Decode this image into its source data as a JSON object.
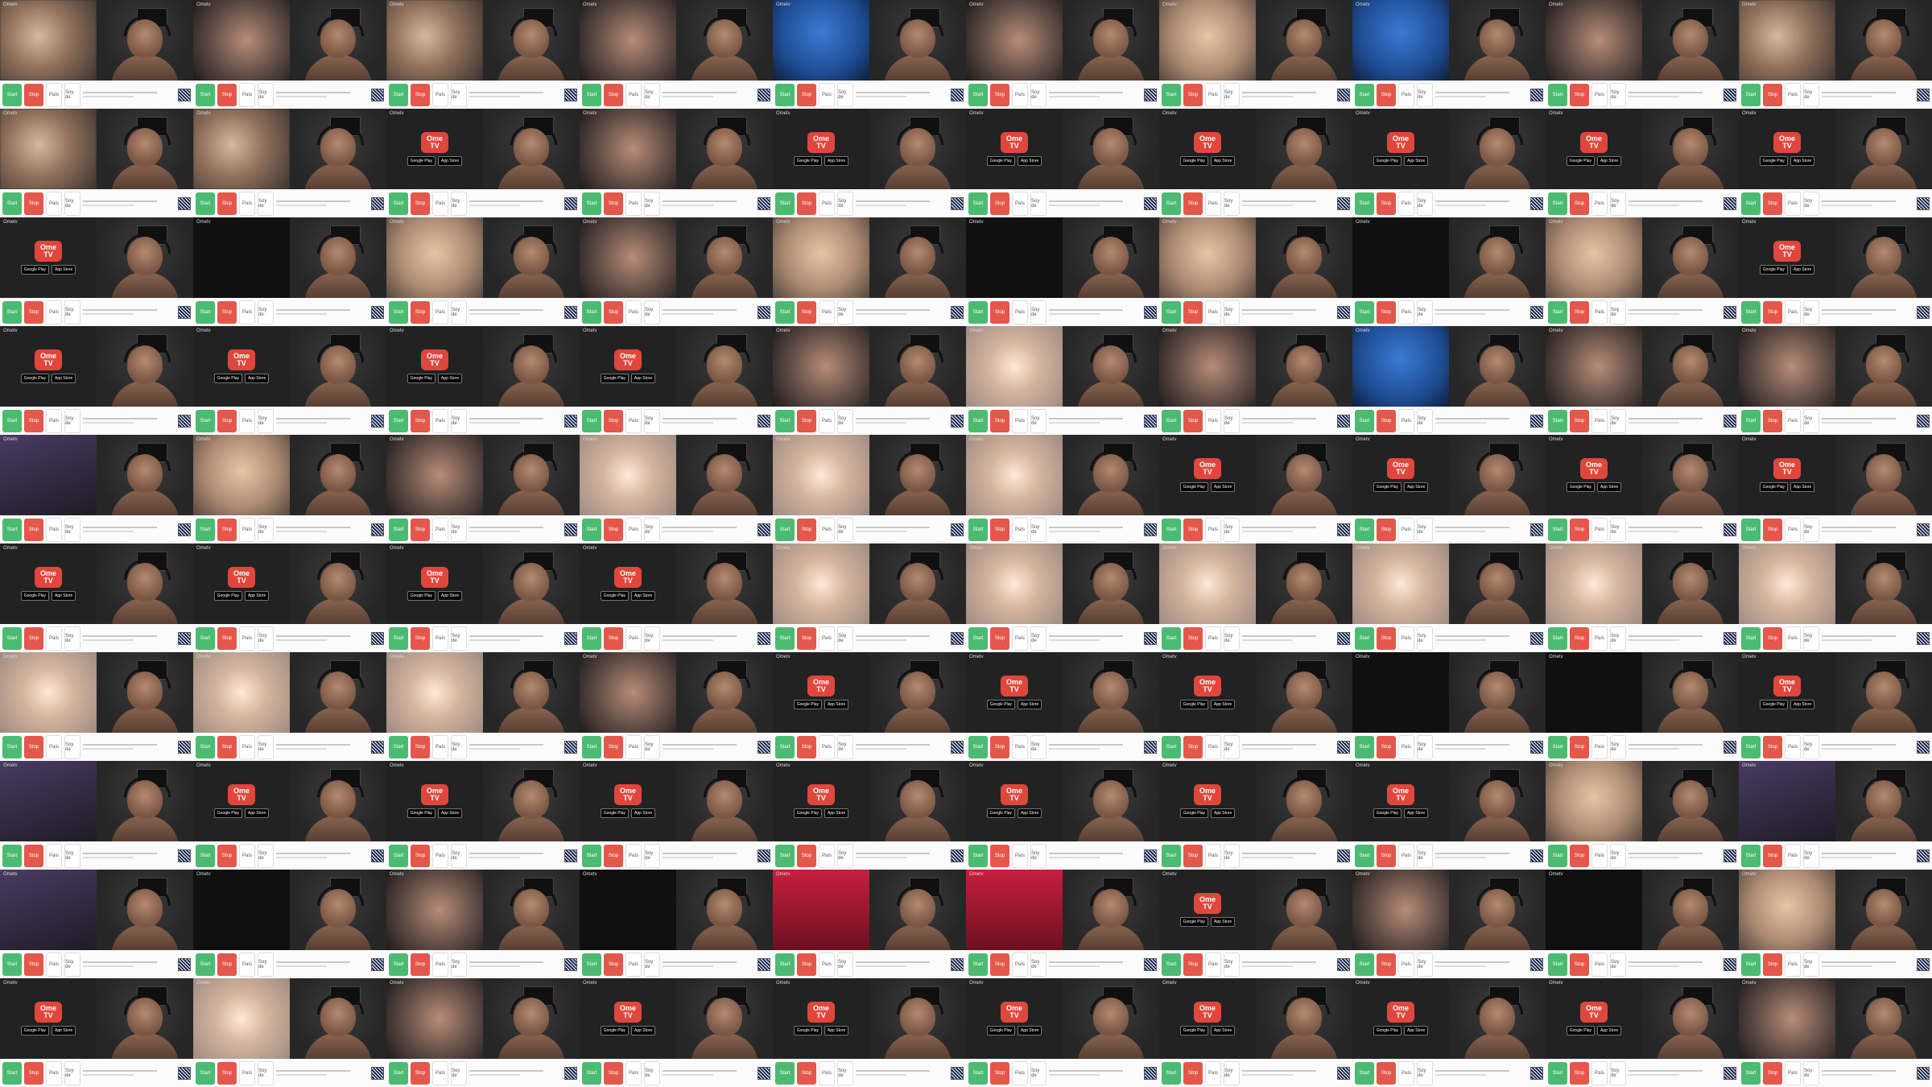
{
  "app": {
    "logo_text": "Ometv"
  },
  "promo": {
    "logo_line1": "Ome",
    "logo_line2": "TV",
    "store1": "Google Play",
    "store2": "App Store"
  },
  "controls": {
    "start_label": "Start",
    "stop_label": "Stop",
    "country_label": "País",
    "gender_label": "Soy de"
  },
  "frames": [
    {
      "remote": "blur-a"
    },
    {
      "remote": "blur-b"
    },
    {
      "remote": "blur-a"
    },
    {
      "remote": "blur-b"
    },
    {
      "remote": "blur-f"
    },
    {
      "remote": "blur-b"
    },
    {
      "remote": "blur-h"
    },
    {
      "remote": "blur-f"
    },
    {
      "remote": "blur-b"
    },
    {
      "remote": "blur-a"
    },
    {
      "remote": "blur-a"
    },
    {
      "remote": "blur-a"
    },
    {
      "remote": "promo"
    },
    {
      "remote": "blur-b"
    },
    {
      "remote": "promo"
    },
    {
      "remote": "promo"
    },
    {
      "remote": "promo"
    },
    {
      "remote": "promo"
    },
    {
      "remote": "promo"
    },
    {
      "remote": "promo"
    },
    {
      "remote": "promo"
    },
    {
      "remote": "blur-e"
    },
    {
      "remote": "blur-h"
    },
    {
      "remote": "blur-b"
    },
    {
      "remote": "blur-h"
    },
    {
      "remote": "blur-e"
    },
    {
      "remote": "blur-h"
    },
    {
      "remote": "blur-e"
    },
    {
      "remote": "blur-h"
    },
    {
      "remote": "promo"
    },
    {
      "remote": "promo"
    },
    {
      "remote": "promo"
    },
    {
      "remote": "promo"
    },
    {
      "remote": "promo"
    },
    {
      "remote": "blur-b"
    },
    {
      "remote": "blur-c"
    },
    {
      "remote": "blur-b"
    },
    {
      "remote": "blur-f"
    },
    {
      "remote": "blur-b"
    },
    {
      "remote": "blur-b"
    },
    {
      "remote": "blur-d"
    },
    {
      "remote": "blur-h"
    },
    {
      "remote": "blur-b"
    },
    {
      "remote": "blur-c"
    },
    {
      "remote": "blur-c"
    },
    {
      "remote": "blur-c"
    },
    {
      "remote": "promo"
    },
    {
      "remote": "promo"
    },
    {
      "remote": "promo"
    },
    {
      "remote": "promo"
    },
    {
      "remote": "promo"
    },
    {
      "remote": "promo"
    },
    {
      "remote": "promo"
    },
    {
      "remote": "promo"
    },
    {
      "remote": "blur-c"
    },
    {
      "remote": "blur-c"
    },
    {
      "remote": "blur-c"
    },
    {
      "remote": "blur-c"
    },
    {
      "remote": "blur-c"
    },
    {
      "remote": "blur-c"
    },
    {
      "remote": "blur-c"
    },
    {
      "remote": "blur-c"
    },
    {
      "remote": "blur-c"
    },
    {
      "remote": "blur-b"
    },
    {
      "remote": "promo"
    },
    {
      "remote": "promo"
    },
    {
      "remote": "promo"
    },
    {
      "remote": "blur-e"
    },
    {
      "remote": "blur-e"
    },
    {
      "remote": "promo"
    },
    {
      "remote": "blur-d"
    },
    {
      "remote": "promo"
    },
    {
      "remote": "promo"
    },
    {
      "remote": "promo"
    },
    {
      "remote": "promo"
    },
    {
      "remote": "promo"
    },
    {
      "remote": "promo"
    },
    {
      "remote": "promo"
    },
    {
      "remote": "blur-h"
    },
    {
      "remote": "blur-d"
    },
    {
      "remote": "blur-d"
    },
    {
      "remote": "blur-e"
    },
    {
      "remote": "blur-b"
    },
    {
      "remote": "blur-e"
    },
    {
      "remote": "blur-g"
    },
    {
      "remote": "blur-g"
    },
    {
      "remote": "promo"
    },
    {
      "remote": "blur-b"
    },
    {
      "remote": "blur-e"
    },
    {
      "remote": "blur-h"
    },
    {
      "remote": "promo"
    },
    {
      "remote": "blur-c"
    },
    {
      "remote": "blur-b"
    },
    {
      "remote": "promo"
    },
    {
      "remote": "promo"
    },
    {
      "remote": "promo"
    },
    {
      "remote": "promo"
    },
    {
      "remote": "promo"
    },
    {
      "remote": "promo"
    },
    {
      "remote": "blur-b"
    }
  ]
}
